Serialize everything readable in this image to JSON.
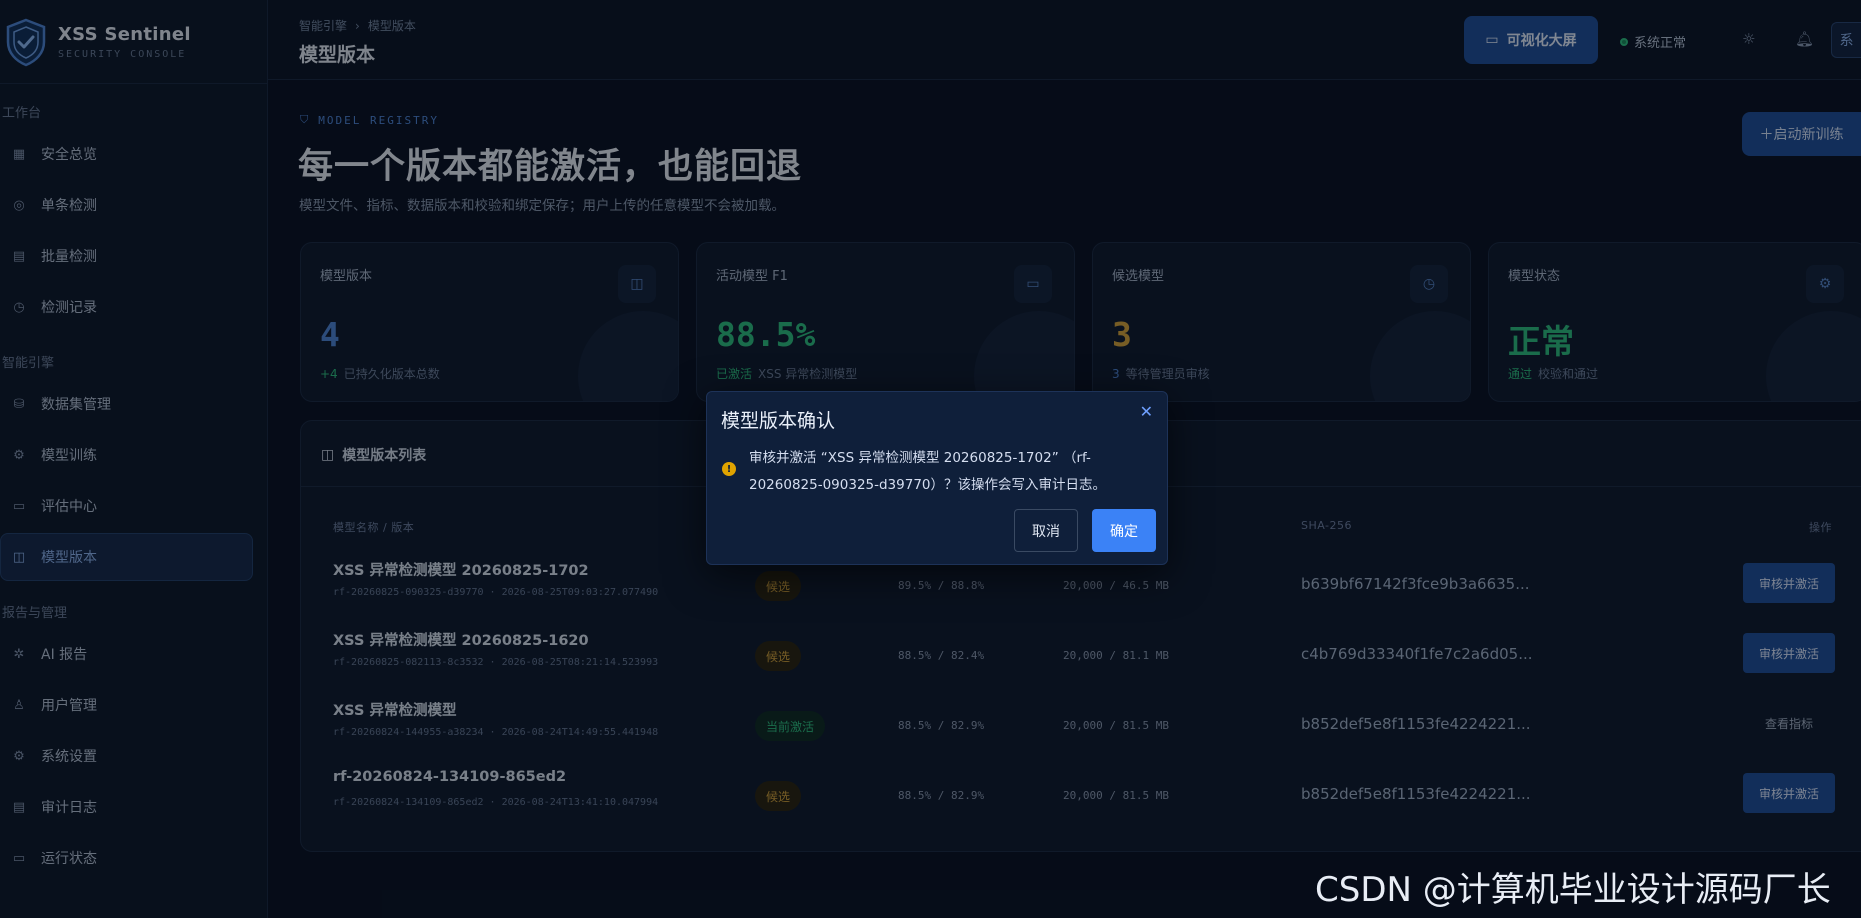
{
  "brand": {
    "name": "XSS Sentinel",
    "subtitle": "SECURITY CONSOLE"
  },
  "sidebar": {
    "groups": [
      {
        "label": "工作台"
      },
      {
        "label": "智能引擎"
      },
      {
        "label": "报告与管理"
      }
    ],
    "items": [
      {
        "label": "安全总览",
        "icon": "grid-icon"
      },
      {
        "label": "单条检测",
        "icon": "crosshair-icon"
      },
      {
        "label": "批量检测",
        "icon": "file-icon"
      },
      {
        "label": "检测记录",
        "icon": "clock-icon"
      },
      {
        "label": "数据集管理",
        "icon": "database-icon"
      },
      {
        "label": "模型训练",
        "icon": "chip-icon"
      },
      {
        "label": "评估中心",
        "icon": "monitor-icon"
      },
      {
        "label": "模型版本",
        "icon": "box-icon"
      },
      {
        "label": "AI 报告",
        "icon": "sparkle-icon"
      },
      {
        "label": "用户管理",
        "icon": "user-icon"
      },
      {
        "label": "系统设置",
        "icon": "gear-icon"
      },
      {
        "label": "审计日志",
        "icon": "document-icon"
      },
      {
        "label": "运行状态",
        "icon": "display-icon"
      }
    ]
  },
  "header": {
    "breadcrumb": [
      "智能引擎",
      "模型版本"
    ],
    "title": "模型版本",
    "viz_button": "可视化大屏",
    "system_status": "系统正常",
    "avatar_text": "系"
  },
  "hero": {
    "eyebrow": "MODEL REGISTRY",
    "title": "每一个版本都能激活，也能回退",
    "description": "模型文件、指标、数据版本和校验和绑定保存；用户上传的任意模型不会被加载。",
    "new_training_button": "＋启动新训练"
  },
  "stats": [
    {
      "label": "模型版本",
      "value": "4",
      "foot_hl": "+4",
      "foot": "已持久化版本总数",
      "color": "#4f86d6",
      "hl_color": "#2fbf7e"
    },
    {
      "label": "活动模型 F1",
      "value": "88.5%",
      "foot_hl": "已激活",
      "foot": "XSS 异常检测模型",
      "color": "#2fbf7e",
      "hl_color": "#2fbf7e"
    },
    {
      "label": "候选模型",
      "value": "3",
      "foot_hl": "3",
      "foot": "等待管理员审核",
      "color": "#d7a43a",
      "hl_color": "#4f86d6"
    },
    {
      "label": "模型状态",
      "value": "正常",
      "foot_hl": "通过",
      "foot": "校验和通过",
      "color": "#2fbf7e",
      "hl_color": "#2fbf7e"
    }
  ],
  "table": {
    "title": "模型版本列表",
    "columns": {
      "name": "模型名称 / 版本",
      "sha": "SHA-256",
      "actions": "操作"
    },
    "rows": [
      {
        "name": "XSS 异常检测模型 20260825-1702",
        "sub": "rf-20260825-090325-d39770 · 2026-08-25T09:03:27.077490",
        "status": "候选",
        "status_type": "cand",
        "metrics": "89.5% / 88.8%",
        "data": "20,000 / 46.5 MB",
        "sha": "b639bf67142f3fce9b3a6635...",
        "action": "审核并激活",
        "action_type": "primary"
      },
      {
        "name": "XSS 异常检测模型 20260825-1620",
        "sub": "rf-20260825-082113-8c3532 · 2026-08-25T08:21:14.523993",
        "status": "候选",
        "status_type": "cand",
        "metrics": "88.5% / 82.4%",
        "data": "20,000 / 81.1 MB",
        "sha": "c4b769d33340f1fe7c2a6d05...",
        "action": "审核并激活",
        "action_type": "primary"
      },
      {
        "name": "XSS 异常检测模型",
        "sub": "rf-20260824-144955-a38234 · 2026-08-24T14:49:55.441948",
        "status": "当前激活",
        "status_type": "active",
        "metrics": "88.5% / 82.9%",
        "data": "20,000 / 81.5 MB",
        "sha": "b852def5e8f1153fe4224221...",
        "action": "查看指标",
        "action_type": "plain"
      },
      {
        "name": "rf-20260824-134109-865ed2",
        "sub": "rf-20260824-134109-865ed2 · 2026-08-24T13:41:10.047994",
        "status": "候选",
        "status_type": "cand",
        "metrics": "88.5% / 82.9%",
        "data": "20,000 / 81.5 MB",
        "sha": "b852def5e8f1153fe4224221...",
        "action": "审核并激活",
        "action_type": "primary"
      }
    ]
  },
  "modal": {
    "title": "模型版本确认",
    "message": "审核并激活 “XSS 异常检测模型 20260825-1702” （rf-20260825-090325-d39770）？该操作会写入审计日志。",
    "cancel": "取消",
    "confirm": "确定"
  },
  "watermark": "CSDN @计算机毕业设计源码厂长"
}
